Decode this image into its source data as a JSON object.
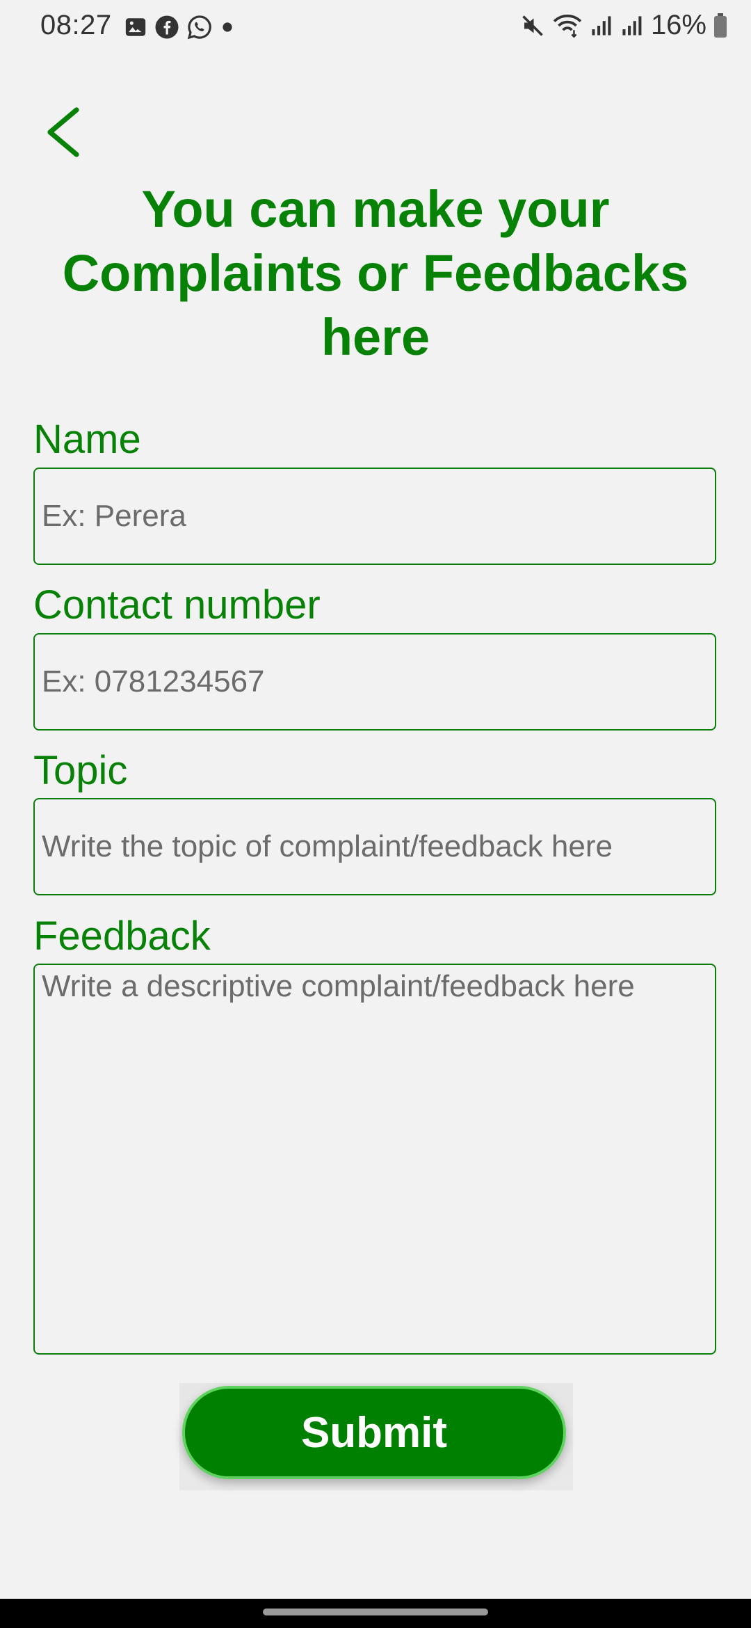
{
  "status_bar": {
    "time": "08:27",
    "left_icons": [
      "gallery-icon",
      "facebook-icon",
      "whatsapp-icon",
      "dot-icon"
    ],
    "right_icons": [
      "mute-icon",
      "wifi-icon",
      "signal-icon",
      "signal-icon"
    ],
    "battery_text": "16%"
  },
  "header": {
    "back_icon": "chevron-left-icon",
    "title": "You can make your Complaints or Feedbacks here"
  },
  "form": {
    "name": {
      "label": "Name",
      "placeholder": "Ex: Perera"
    },
    "contact": {
      "label": "Contact number",
      "placeholder": "Ex: 0781234567"
    },
    "topic": {
      "label": "Topic",
      "placeholder": "Write the topic of complaint/feedback here"
    },
    "feedback": {
      "label": "Feedback",
      "placeholder": "Write a descriptive complaint/feedback here"
    },
    "submit_label": "Submit"
  },
  "colors": {
    "accent": "#078207",
    "button": "#008000",
    "button_border": "#5fd25f",
    "background": "#f2f2f2"
  }
}
